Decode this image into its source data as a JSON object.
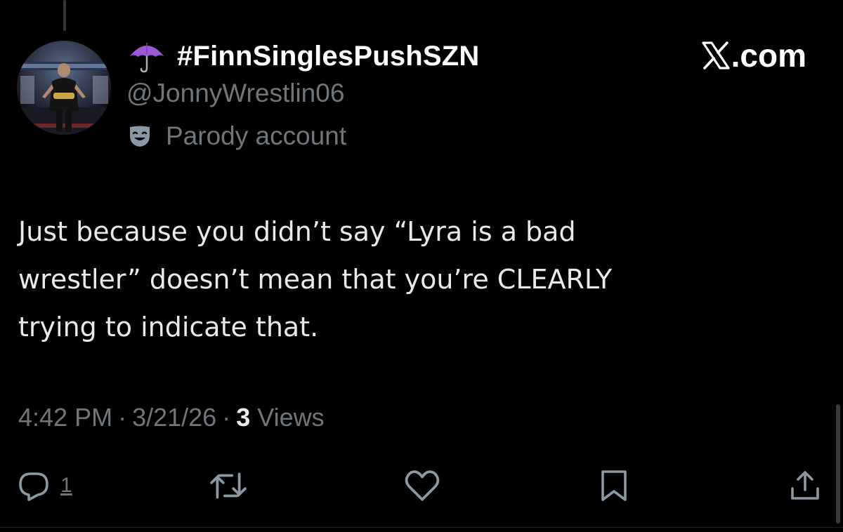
{
  "tweet": {
    "display_name": "#FinnSinglesPushSZN",
    "display_name_emoji": "umbrella-purple",
    "handle": "@JonnyWrestlin06",
    "account_label": "Parody account",
    "account_label_icon": "theater-mask-icon",
    "text_lines": [
      "Just because you didn’t say “Lyra is a bad",
      "wrestler” doesn’t mean that you’re CLEARLY",
      "trying to indicate that."
    ],
    "time": "4:42 PM",
    "separator": "·",
    "date": "3/21/26",
    "views_count": "3",
    "views_label": "Views"
  },
  "brand": {
    "text": ".com",
    "logo": "x-logo-icon"
  },
  "actions": {
    "reply_count": "1",
    "icons": [
      "reply-icon",
      "retweet-icon",
      "like-icon",
      "bookmark-icon",
      "share-icon"
    ]
  },
  "colors": {
    "background": "#000000",
    "primary_text": "#e7e9ea",
    "secondary_text": "#71767b",
    "umbrella": "#9b59d6"
  }
}
